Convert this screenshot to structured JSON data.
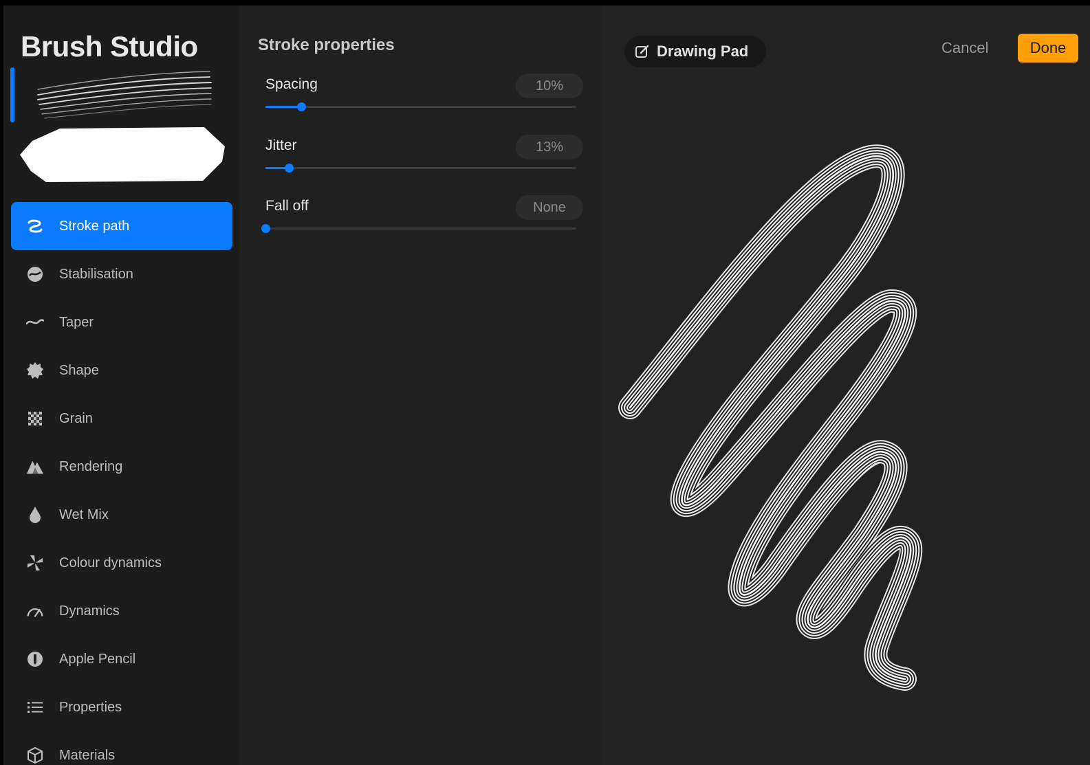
{
  "app": {
    "title": "Brush Studio"
  },
  "sidebar": {
    "items": [
      {
        "label": "Stroke path",
        "icon": "stroke-path-icon",
        "active": true
      },
      {
        "label": "Stabilisation",
        "icon": "stabilisation-icon",
        "active": false
      },
      {
        "label": "Taper",
        "icon": "taper-icon",
        "active": false
      },
      {
        "label": "Shape",
        "icon": "shape-icon",
        "active": false
      },
      {
        "label": "Grain",
        "icon": "grain-icon",
        "active": false
      },
      {
        "label": "Rendering",
        "icon": "rendering-icon",
        "active": false
      },
      {
        "label": "Wet Mix",
        "icon": "wet-mix-icon",
        "active": false
      },
      {
        "label": "Colour dynamics",
        "icon": "colour-dynamics-icon",
        "active": false
      },
      {
        "label": "Dynamics",
        "icon": "dynamics-icon",
        "active": false
      },
      {
        "label": "Apple Pencil",
        "icon": "apple-pencil-icon",
        "active": false
      },
      {
        "label": "Properties",
        "icon": "properties-icon",
        "active": false
      },
      {
        "label": "Materials",
        "icon": "materials-icon",
        "active": false
      }
    ]
  },
  "panel": {
    "title": "Stroke properties",
    "settings": [
      {
        "label": "Spacing",
        "value": "10%",
        "level": 0.115
      },
      {
        "label": "Jitter",
        "value": "13%",
        "level": 0.075
      },
      {
        "label": "Fall off",
        "value": "None",
        "level": 0.0
      }
    ]
  },
  "pad": {
    "title": "Drawing Pad",
    "cancel_label": "Cancel",
    "done_label": "Done"
  },
  "colors": {
    "accent": "#0a7bff",
    "done": "#ff9f0a",
    "background": "#1b1b1b"
  }
}
